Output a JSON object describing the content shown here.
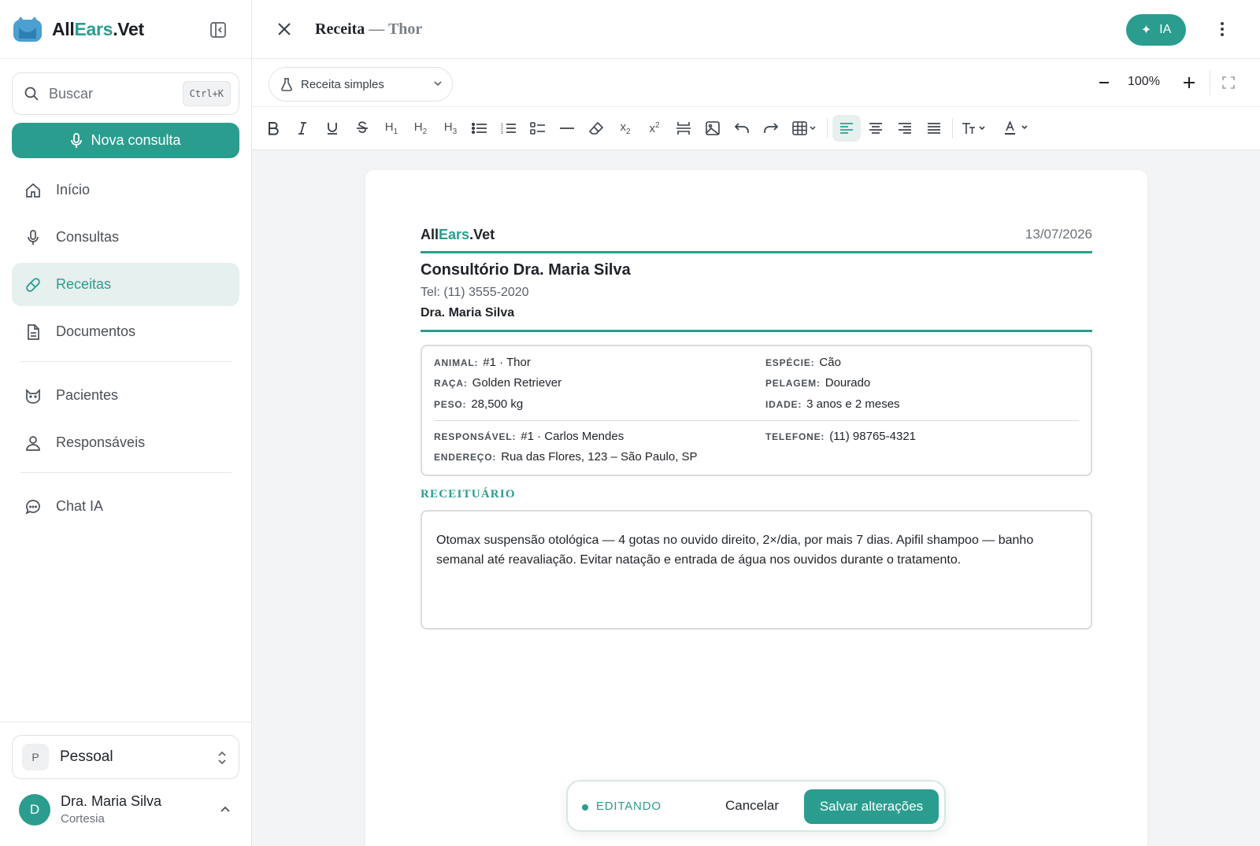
{
  "colors": {
    "accent": "#2a9d8f",
    "active_bg": "#e6f0ee"
  },
  "brand": {
    "part1": "All",
    "part2": "Ears",
    "part3": ".Vet"
  },
  "sidebar": {
    "search": {
      "placeholder": "Buscar",
      "shortcut": "Ctrl+K"
    },
    "new_button": "Nova consulta",
    "nav": [
      {
        "label": "Início",
        "icon": "home-icon"
      },
      {
        "label": "Consultas",
        "icon": "microphone-icon"
      },
      {
        "label": "Receitas",
        "icon": "pill-icon",
        "active": true
      },
      {
        "label": "Documentos",
        "icon": "document-icon"
      },
      {
        "label": "Pacientes",
        "icon": "cat-icon"
      },
      {
        "label": "Responsáveis",
        "icon": "person-icon"
      },
      {
        "label": "Chat IA",
        "icon": "chat-icon"
      }
    ],
    "workspace": {
      "badge": "P",
      "name": "Pessoal"
    },
    "user": {
      "initial": "D",
      "name": "Dra. Maria Silva",
      "plan": "Cortesia"
    }
  },
  "header": {
    "title": "Receita",
    "separator": "—",
    "subject": "Thor",
    "ai_button": "IA"
  },
  "toolbar": {
    "template": "Receita simples",
    "zoom": "100%"
  },
  "document": {
    "brand": {
      "part1": "All",
      "part2": "Ears",
      "part3": ".Vet"
    },
    "date": "13/07/2026",
    "clinic": "Consultório Dra. Maria Silva",
    "phone": "Tel: (11) 3555-2020",
    "doctor": "Dra. Maria Silva",
    "info": {
      "animal": {
        "label": "ANIMAL:",
        "value": "#1 · Thor"
      },
      "especie": {
        "label": "ESPÉCIE:",
        "value": "Cão"
      },
      "raca": {
        "label": "RAÇA:",
        "value": "Golden Retriever"
      },
      "pelagem": {
        "label": "PELAGEM:",
        "value": "Dourado"
      },
      "peso": {
        "label": "PESO:",
        "value": "28,500 kg"
      },
      "idade": {
        "label": "IDADE:",
        "value": "3 anos e 2 meses"
      },
      "responsavel": {
        "label": "RESPONSÁVEL:",
        "value": "#1 · Carlos Mendes"
      },
      "telefone": {
        "label": "TELEFONE:",
        "value": "(11) 98765-4321"
      },
      "endereco": {
        "label": "ENDEREÇO:",
        "value": "Rua das Flores, 123 – São Paulo, SP"
      }
    },
    "rx_label": "RECEITUÁRIO",
    "rx_text": "Otomax suspensão otológica — 4 gotas no ouvido direito, 2×/dia, por mais 7 dias. Apifil shampoo — banho semanal até reavaliação. Evitar natação e entrada de água nos ouvidos durante o tratamento."
  },
  "editbar": {
    "status": "EDITANDO",
    "cancel": "Cancelar",
    "save": "Salvar alterações"
  }
}
